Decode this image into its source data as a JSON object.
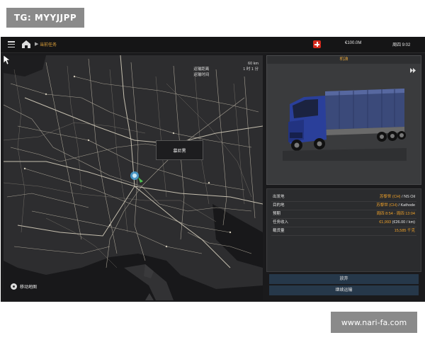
{
  "watermarks": {
    "top": "TG: MYYJJPP",
    "bottom": "www.nari-fa.com"
  },
  "topbar": {
    "breadcrumb": "当前任务",
    "money": "€100.0M",
    "time": "周四 9:02"
  },
  "map": {
    "info_label_1": "运输距离",
    "info_label_2": "运输时间",
    "distance": "60 km",
    "duration": "1 时 1 分",
    "popup_label": "慕尼黑",
    "map_control_label": "移动地图"
  },
  "vehicle_panel": {
    "title": "机油"
  },
  "details": {
    "rows": [
      {
        "label": "出发地",
        "value_hl": "苏黎世 (CH)",
        "value_rest": " / NS Oil"
      },
      {
        "label": "目的地",
        "value_hl": "苏黎世 (CH)",
        "value_rest": " / Kathode"
      },
      {
        "label": "预期",
        "value_hl": "周四 8:54 - 周四 13:04",
        "value_rest": ""
      },
      {
        "label": "任务收入",
        "value_hl": "€1,993",
        "value_rest": " (€26.00 / km)"
      },
      {
        "label": "载货量",
        "value_hl": "15,585 千克",
        "value_rest": ""
      }
    ]
  },
  "buttons": {
    "abandon": "放弃",
    "continue": "继续运输"
  },
  "colors": {
    "accent": "#f0a22a",
    "button_bg": "#26384a",
    "map_bg": "#2b2b2d"
  }
}
